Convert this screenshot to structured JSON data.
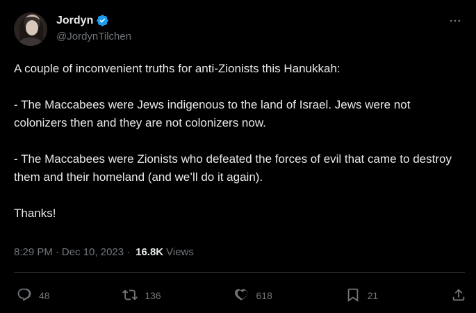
{
  "author": {
    "display_name": "Jordyn",
    "handle": "@JordynTilchen",
    "verified": true
  },
  "more_icon": "ellipsis-icon",
  "tweet": {
    "paragraphs": [
      "A couple of inconvenient truths for anti-Zionists this Hanukkah:",
      "- The Maccabees were Jews indigenous to the land of Israel. Jews were not colonizers then and they are not colonizers now.",
      "- The Maccabees were Zionists who defeated the forces of evil that came to destroy them and their homeland (and we’ll do it again).",
      "Thanks!"
    ]
  },
  "meta": {
    "time": "8:29 PM",
    "date": "Dec 10, 2023",
    "separator": "·",
    "views_count": "16.8K",
    "views_label": "Views"
  },
  "actions": {
    "reply": {
      "count": "48",
      "icon": "reply-icon"
    },
    "retweet": {
      "count": "136",
      "icon": "retweet-icon"
    },
    "like": {
      "count": "618",
      "icon": "heart-icon"
    },
    "bookmark": {
      "count": "21",
      "icon": "bookmark-icon"
    },
    "share": {
      "icon": "share-icon"
    }
  },
  "colors": {
    "background": "#000000",
    "text": "#e7e9ea",
    "muted": "#71767b",
    "verified_blue": "#1d9bf0",
    "divider": "#2f3336"
  }
}
